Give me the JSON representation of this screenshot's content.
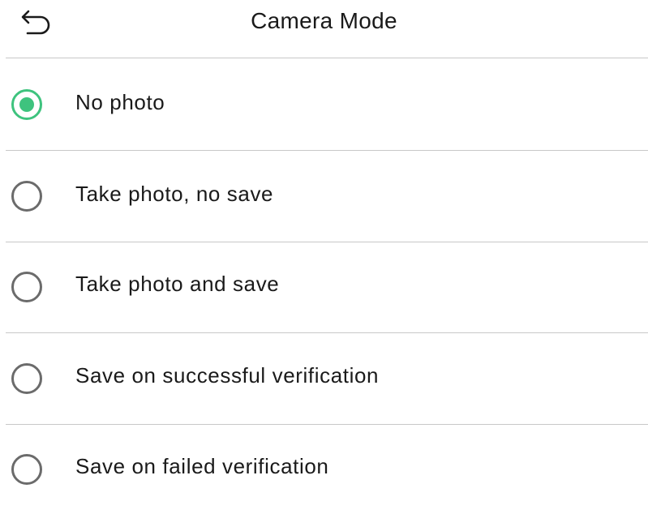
{
  "header": {
    "title": "Camera Mode",
    "back_icon": "back-arrow-icon"
  },
  "colors": {
    "accent": "#3ec37e",
    "radio_border": "#6b6b6b",
    "divider": "#c8c8c8",
    "text": "#1a1a1a"
  },
  "options": [
    {
      "label": "No photo",
      "selected": true
    },
    {
      "label": "Take photo, no save",
      "selected": false
    },
    {
      "label": "Take photo and save",
      "selected": false
    },
    {
      "label": "Save on successful verification",
      "selected": false
    },
    {
      "label": "Save on failed verification",
      "selected": false
    }
  ]
}
